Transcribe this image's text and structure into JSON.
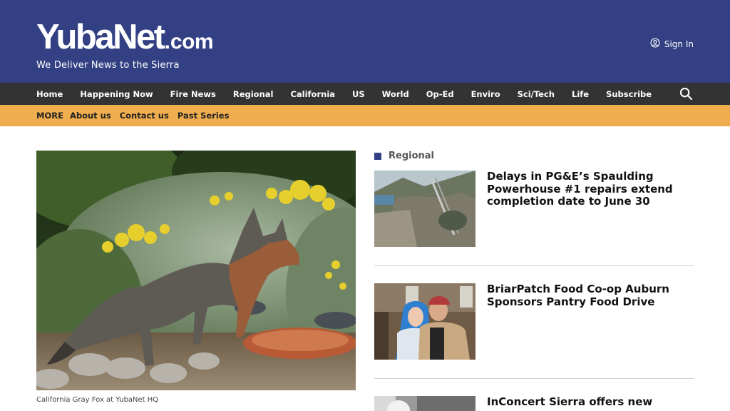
{
  "header": {
    "logo_main": "YubaNet",
    "logo_dot": ".",
    "logo_com": "com",
    "tagline": "We Deliver News to the Sierra",
    "signin_label": "Sign In"
  },
  "nav": {
    "items": [
      "Home",
      "Happening Now",
      "Fire News",
      "Regional",
      "California",
      "US",
      "World",
      "Op-Ed",
      "Enviro",
      "Sci/Tech",
      "Life",
      "Subscribe"
    ]
  },
  "subnav": {
    "more_label": "MORE",
    "items": [
      "About us",
      "Contact us",
      "Past Series"
    ]
  },
  "featured": {
    "caption": "California Gray Fox at YubaNet HQ"
  },
  "sidebar": {
    "section_label": "Regional",
    "articles": [
      {
        "headline": "Delays in PG&E’s Spaulding Powerhouse #1 repairs extend completion date to June 30"
      },
      {
        "headline": "BriarPatch Food Co-op Auburn Sponsors Pantry Food Drive"
      },
      {
        "headline": "InConcert Sierra offers new"
      }
    ]
  },
  "colors": {
    "header_bg": "#334184",
    "nav_bg": "#333333",
    "subnav_bg": "#f0ad4e"
  },
  "icons": {
    "signin": "user-circle-icon",
    "search": "search-icon"
  }
}
